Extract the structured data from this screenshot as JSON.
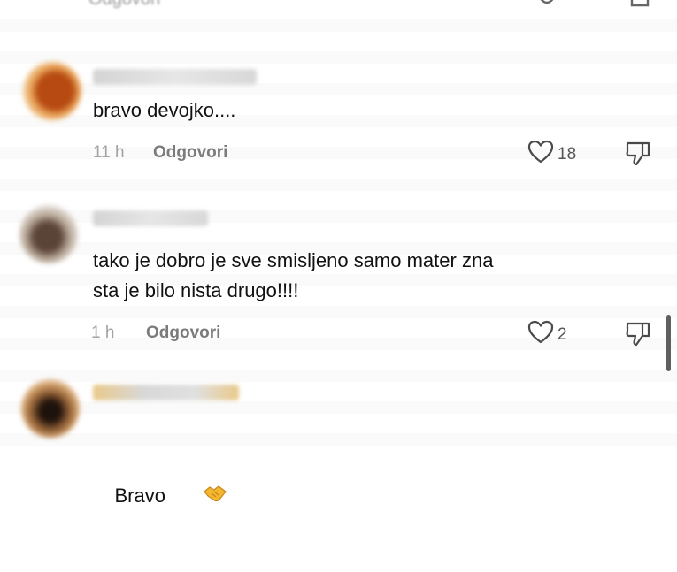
{
  "top_partial": {
    "reply_label": "Odgovori"
  },
  "comments": [
    {
      "text": "bravo devojko....",
      "time": "11 h",
      "reply_label": "Odgovori",
      "likes": "18"
    },
    {
      "text": "tako je dobro je sve smisljeno samo mater zna\nsta je bilo nista drugo!!!!",
      "time": "1 h",
      "reply_label": "Odgovori",
      "likes": "2"
    },
    {
      "text": "Bravo",
      "emoji": "handshake-icon"
    }
  ],
  "colors": {
    "text": "#111111",
    "muted": "#a3a3a3",
    "reply": "#7b7b7b",
    "icon": "#4a4a4a",
    "scrollbar": "#5f5f5f"
  }
}
